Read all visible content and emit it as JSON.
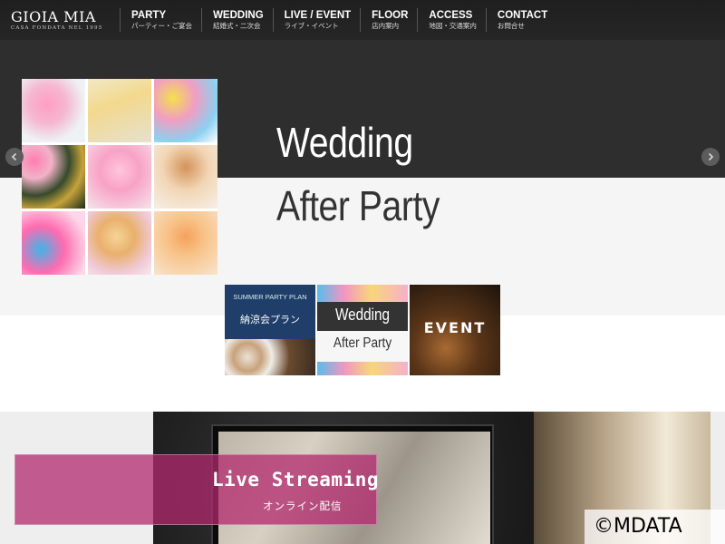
{
  "brand": {
    "name": "GIOIA MIA",
    "tagline": "CASA FONDATA NEL 1995"
  },
  "nav": [
    {
      "en": "PARTY",
      "ja": "パーティー・ご宴会"
    },
    {
      "en": "WEDDING",
      "ja": "結婚式・二次会"
    },
    {
      "en": "LIVE / EVENT",
      "ja": "ライブ・イベント"
    },
    {
      "en": "FLOOR",
      "ja": "店内案内"
    },
    {
      "en": "ACCESS",
      "ja": "地図・交通案内"
    },
    {
      "en": "CONTACT",
      "ja": "お問合せ"
    }
  ],
  "hero": {
    "title_line1": "Wedding",
    "title_line2": "After Party",
    "prev_icon": "chevron-left-icon",
    "next_icon": "chevron-right-icon"
  },
  "thumbnails": {
    "summer": {
      "en": "SUMMER PARTY PLAN",
      "ja": "納涼会プラン"
    },
    "wedding": {
      "line1": "Wedding",
      "line2": "After Party"
    },
    "event": {
      "label": "EVENT"
    }
  },
  "live": {
    "title": "Live Streaming",
    "subtitle": "オンライン配信"
  },
  "watermark": "©MDATA",
  "colors": {
    "nav_bg": "#222222",
    "hero_dark": "#2e2e2e",
    "summer_blue": "#1f3e6a",
    "live_pink": "#b2286e"
  }
}
